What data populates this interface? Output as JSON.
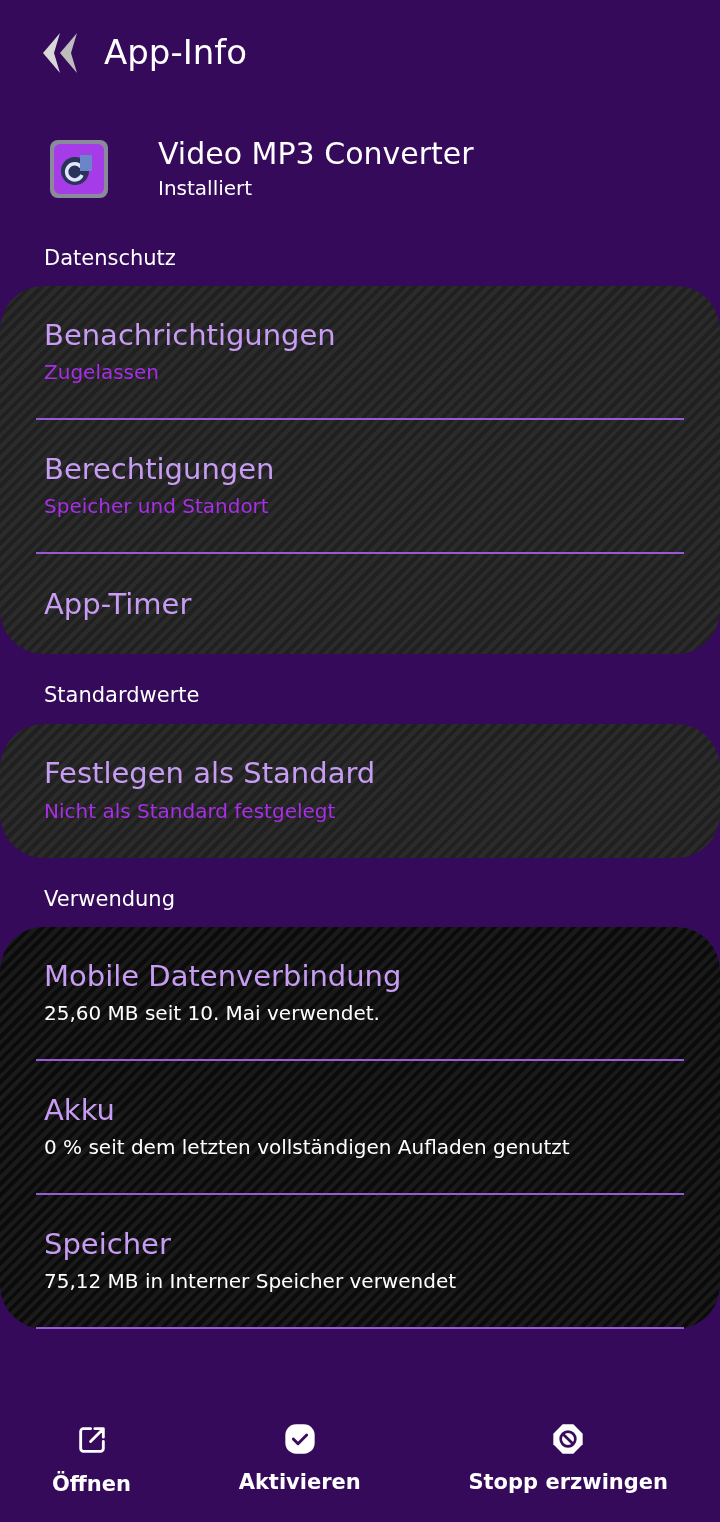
{
  "header": {
    "title": "App-Info"
  },
  "app": {
    "name": "Video MP3 Converter",
    "status": "Installiert"
  },
  "sections": [
    {
      "heading": "Datenschutz",
      "more_below": false,
      "items": [
        {
          "title": "Benachrichtigungen",
          "kind": "status",
          "subtitle": "Zugelassen"
        },
        {
          "title": "Berechtigungen",
          "kind": "status",
          "subtitle": "Speicher und Standort"
        },
        {
          "title": "App-Timer",
          "kind": "plain"
        }
      ]
    },
    {
      "heading": "Standardwerte",
      "more_below": false,
      "items": [
        {
          "title": "Festlegen als Standard",
          "kind": "status",
          "subtitle": "Nicht als Standard festgelegt"
        }
      ]
    },
    {
      "heading": "Verwendung",
      "more_below": true,
      "items": [
        {
          "title": "Mobile Datenverbindung",
          "kind": "usage",
          "subtitle": "25,60 MB seit 10. Mai verwendet."
        },
        {
          "title": "Akku",
          "kind": "usage",
          "subtitle": "0 % seit dem letzten vollständigen Aufladen genutzt"
        },
        {
          "title": "Speicher",
          "kind": "usage",
          "subtitle": "75,12 MB in Interner Speicher verwendet"
        }
      ]
    }
  ],
  "actions": [
    {
      "label": "Öffnen",
      "kind": "open"
    },
    {
      "label": "Aktivieren",
      "kind": "enable"
    },
    {
      "label": "Stopp erzwingen",
      "kind": "stop"
    }
  ]
}
